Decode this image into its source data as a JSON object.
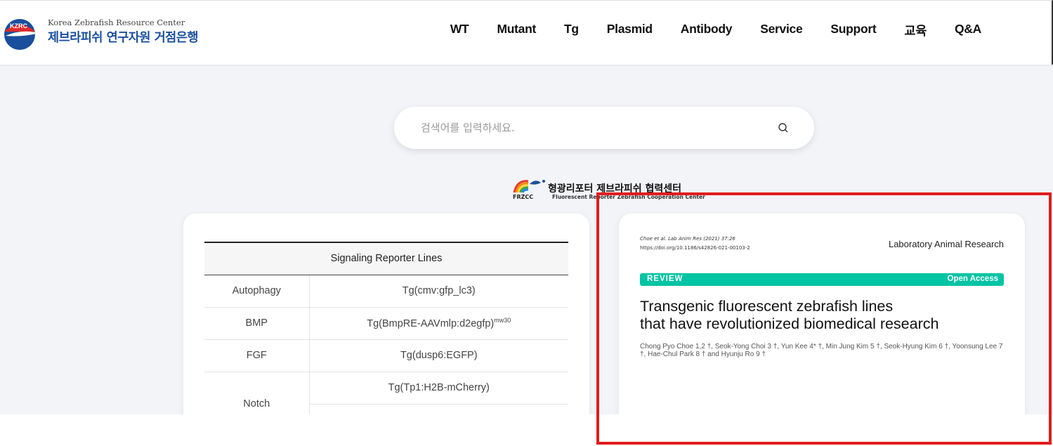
{
  "header": {
    "logo_en": "Korea Zebrafish Resource Center",
    "logo_ko": "제브라피쉬 연구자원 거점은행",
    "logo_badge": "KZRC",
    "nav": [
      "WT",
      "Mutant",
      "Tg",
      "Plasmid",
      "Antibody",
      "Service",
      "Support",
      "교육",
      "Q&A"
    ]
  },
  "search": {
    "placeholder": "검색어를 입력하세요.",
    "icon": "search-icon"
  },
  "partner": {
    "ko": "형광리포터 제브라피쉬 협력센터",
    "abbr": "FRZCC",
    "en": "Fluorescent Reporter Zebrafish Cooperation Center"
  },
  "table": {
    "header": "Signaling Reporter Lines",
    "rows": [
      {
        "category": "Autophagy",
        "line": "Tg(cmv:gfp_lc3)",
        "sup": ""
      },
      {
        "category": "BMP",
        "line": "Tg(BmpRE-AAVmlp:d2egfp)",
        "sup": "mw30"
      },
      {
        "category": "FGF",
        "line": "Tg(dusp6:EGFP)",
        "sup": ""
      },
      {
        "category": "Notch",
        "line": "Tg(Tp1:H2B-mCherry)",
        "sup": ""
      }
    ]
  },
  "paper": {
    "cite": "Choe et al. Lab Anim Res       (2021) 37:26",
    "doi": "https://doi.org/10.1186/s42826-021-00103-2",
    "journal": "Laboratory Animal Research",
    "review": "REVIEW",
    "open_access": "Open Access",
    "title_line1": "Transgenic fluorescent zebrafish lines",
    "title_line2": "that have revolutionized biomedical research",
    "authors": "Chong Pyo Choe 1,2 †, Seok-Yong Choi 3 †, Yun Kee 4* †, Min Jung Kim 5 †, Seok-Hyung Kim 6 †, Yoonsung Lee 7 †, Hae-Chul Park 8 † and Hyunju Ro 9 †"
  },
  "colors": {
    "brand_blue": "#1a4f9c",
    "accent_teal": "#00c4a3",
    "highlight_red": "#e01c1c"
  }
}
